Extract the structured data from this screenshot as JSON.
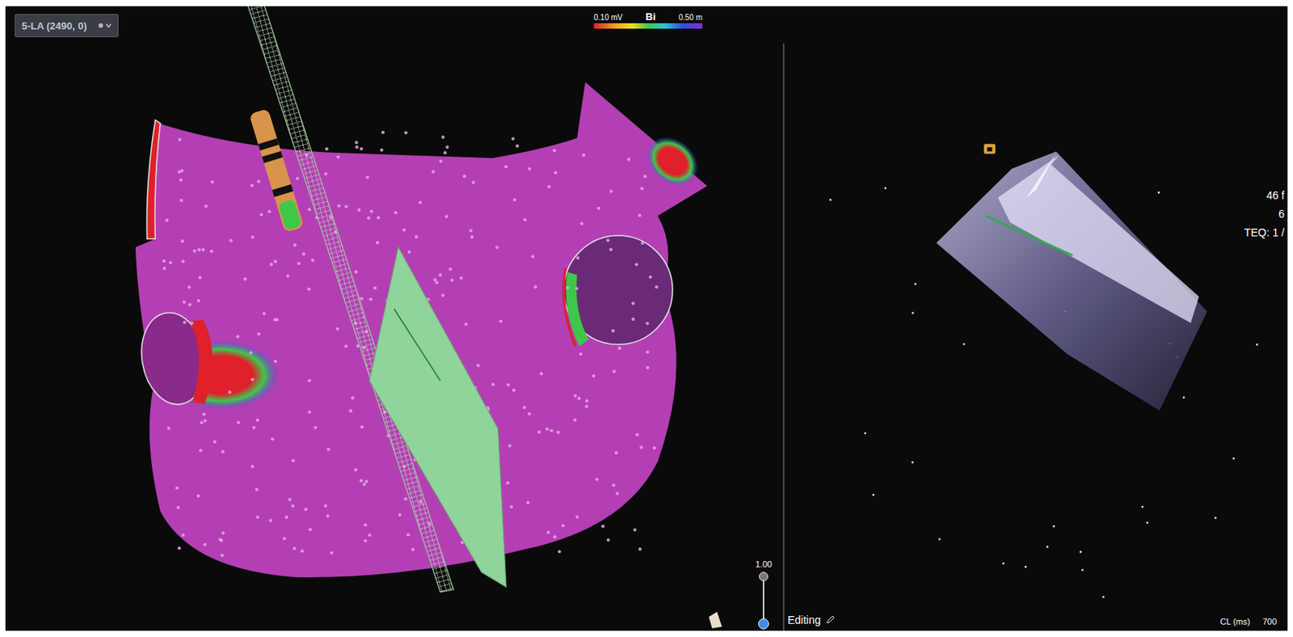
{
  "map": {
    "label": "5-LA (2490, 0)",
    "scale": {
      "min": "0.10 mV",
      "mode": "Bi",
      "max": "0.50 m"
    }
  },
  "zoom": {
    "value": "1.00",
    "level": 0
  },
  "ultrasound": {
    "readings": [
      "46 f",
      "6",
      "TEQ: 1 /"
    ]
  },
  "status_bar": {
    "mode": "Editing",
    "cycle_label": "CL (ms)",
    "cycle_value": "700"
  }
}
